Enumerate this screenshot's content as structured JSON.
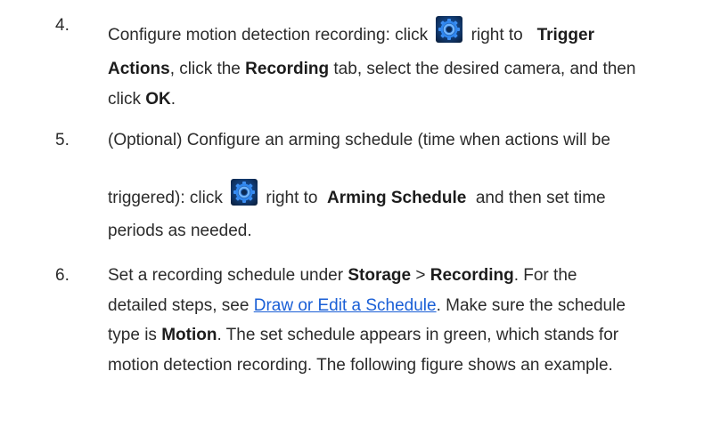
{
  "steps": [
    {
      "number": "4.",
      "line1_pre": "Configure motion detection recording: click",
      "line1_post": "right to",
      "line1_bold": "Trigger",
      "line2_bold1": "Actions",
      "line2_text1": ", click the",
      "line2_bold2": "Recording",
      "line2_text2": " tab, select the desired camera, and then",
      "line3_text": "click ",
      "line3_bold": "OK",
      "line3_end": "."
    },
    {
      "number": "5.",
      "line1": "(Optional) Configure an arming schedule (time when actions will be",
      "line2_pre": "triggered): click",
      "line2_mid": "right to",
      "line2_bold": "Arming Schedule",
      "line2_post": "and then set time",
      "line3": "periods as needed."
    },
    {
      "number": "6.",
      "line1_pre": "Set a recording schedule under ",
      "line1_bold1": "Storage",
      "line1_sep": " > ",
      "line1_bold2": "Recording",
      "line1_post": ". For the",
      "line2_pre": "detailed steps, see ",
      "line2_link": "Draw or Edit a Schedule",
      "line2_post": ". Make sure the schedule",
      "line3_pre": "type is ",
      "line3_bold": "Motion",
      "line3_post": ". The set schedule appears in green, which stands for",
      "line4": "motion detection recording. The following figure shows an example."
    }
  ],
  "icons": {
    "settings": "gear-icon"
  },
  "colors": {
    "link": "#1a5fd6",
    "gear": "#1e73d8"
  }
}
